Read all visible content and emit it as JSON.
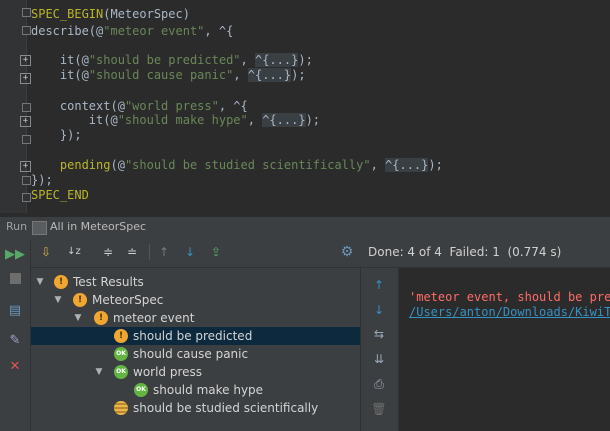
{
  "editor": {
    "lines": {
      "l1": {
        "macro": "SPEC_BEGIN",
        "rest": "(MeteorSpec)"
      },
      "l2": {
        "fn": "describe",
        "open": "(@",
        "str": "\"meteor event\"",
        "close": ", ^{"
      },
      "l4": {
        "fn": "it",
        "open": "(@",
        "str": "\"should be predicted\"",
        "sep": ", ",
        "fold": "^{...}",
        "end": ");"
      },
      "l5": {
        "fn": "it",
        "open": "(@",
        "str": "\"should cause panic\"",
        "sep": ", ",
        "fold": "^{...}",
        "end": ");"
      },
      "l7": {
        "fn": "context",
        "open": "(@",
        "str": "\"world press\"",
        "close": ", ^{"
      },
      "l8": {
        "fn": "it",
        "open": "(@",
        "str": "\"should make hype\"",
        "sep": ", ",
        "fold": "^{...}",
        "end": ");"
      },
      "l9": {
        "text": "});"
      },
      "l11": {
        "fn": "pending",
        "open": "(@",
        "str": "\"should be studied scientifically\"",
        "sep": ", ",
        "fold": "^{...}",
        "end": ");"
      },
      "l12": {
        "text": "});"
      },
      "l13": {
        "macro": "SPEC_END"
      }
    }
  },
  "runbar": {
    "run_label": "Run",
    "tab_label": "All in MeteorSpec"
  },
  "status": {
    "text": "Done: 4 of 4  Failed: 1  (0.774 s)"
  },
  "tree": {
    "root": "Test Results",
    "spec": "MeteorSpec",
    "group": "meteor event",
    "t1": "should be predicted",
    "t2": "should cause panic",
    "ctx": "world press",
    "t3": "should make hype",
    "t4": "should be studied scientifically",
    "ok_badge": "OK",
    "warn_badge": "!"
  },
  "output": {
    "line1": "'meteor event, should be pred",
    "line2": "/Users/anton/Downloads/KiwiTe"
  },
  "colors": {
    "accent_blue": "#3592c4",
    "fail_red": "#ff6b68",
    "warn": "#f0a732",
    "ok": "#62b543",
    "selection": "#0d293e"
  }
}
